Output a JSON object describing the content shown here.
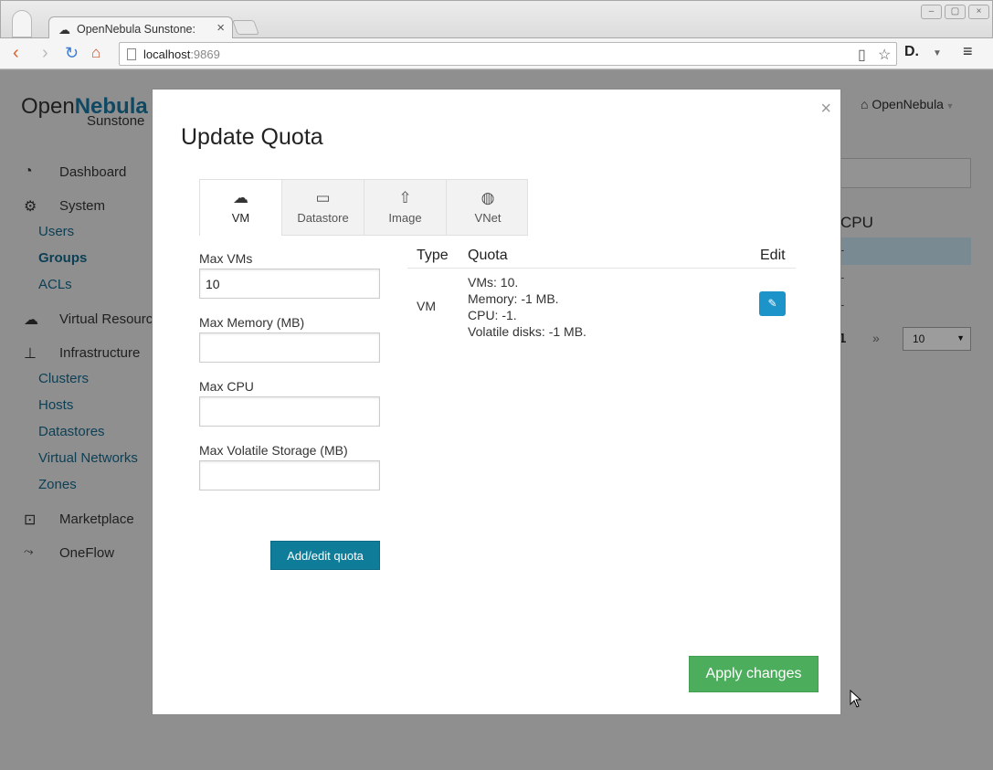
{
  "browser": {
    "tab_title": "OpenNebula Sunstone:",
    "url_host": "localhost",
    "url_port": ":9869"
  },
  "page_bg": {
    "brand_part1": "Open",
    "brand_part2": "Nebula",
    "brand_sub": "Sunstone",
    "user_menu": "OpenNebula",
    "table_header": "CPU",
    "pagination_page": "1",
    "pagination_next": "»",
    "page_size": "10",
    "row_dashes": [
      "-",
      "-",
      "-"
    ],
    "sidebar": {
      "dashboard": "Dashboard",
      "system": "System",
      "users": "Users",
      "groups": "Groups",
      "acls": "ACLs",
      "virtual_resources": "Virtual Resources",
      "infrastructure": "Infrastructure",
      "clusters": "Clusters",
      "hosts": "Hosts",
      "datastores": "Datastores",
      "virtual_networks": "Virtual Networks",
      "zones": "Zones",
      "marketplace": "Marketplace",
      "oneflow": "OneFlow"
    }
  },
  "modal": {
    "title": "Update Quota",
    "close": "×",
    "tabs": [
      {
        "label": "VM",
        "icon": "cloud-icon"
      },
      {
        "label": "Datastore",
        "icon": "folder-open-icon"
      },
      {
        "label": "Image",
        "icon": "upload-icon"
      },
      {
        "label": "VNet",
        "icon": "globe-icon"
      }
    ],
    "form": {
      "max_vms_label": "Max VMs",
      "max_vms_value": "10",
      "max_memory_label": "Max Memory (MB)",
      "max_memory_value": "",
      "max_cpu_label": "Max CPU",
      "max_cpu_value": "",
      "max_volatile_label": "Max Volatile Storage (MB)",
      "max_volatile_value": "",
      "add_button": "Add/edit quota"
    },
    "quota_table": {
      "headers": {
        "type": "Type",
        "quota": "Quota",
        "edit": "Edit"
      },
      "rows": [
        {
          "type": "VM",
          "details": [
            "VMs: 10.",
            "Memory: -1 MB.",
            "CPU: -1.",
            "Volatile disks: -1 MB."
          ]
        }
      ]
    },
    "apply_button": "Apply changes"
  }
}
